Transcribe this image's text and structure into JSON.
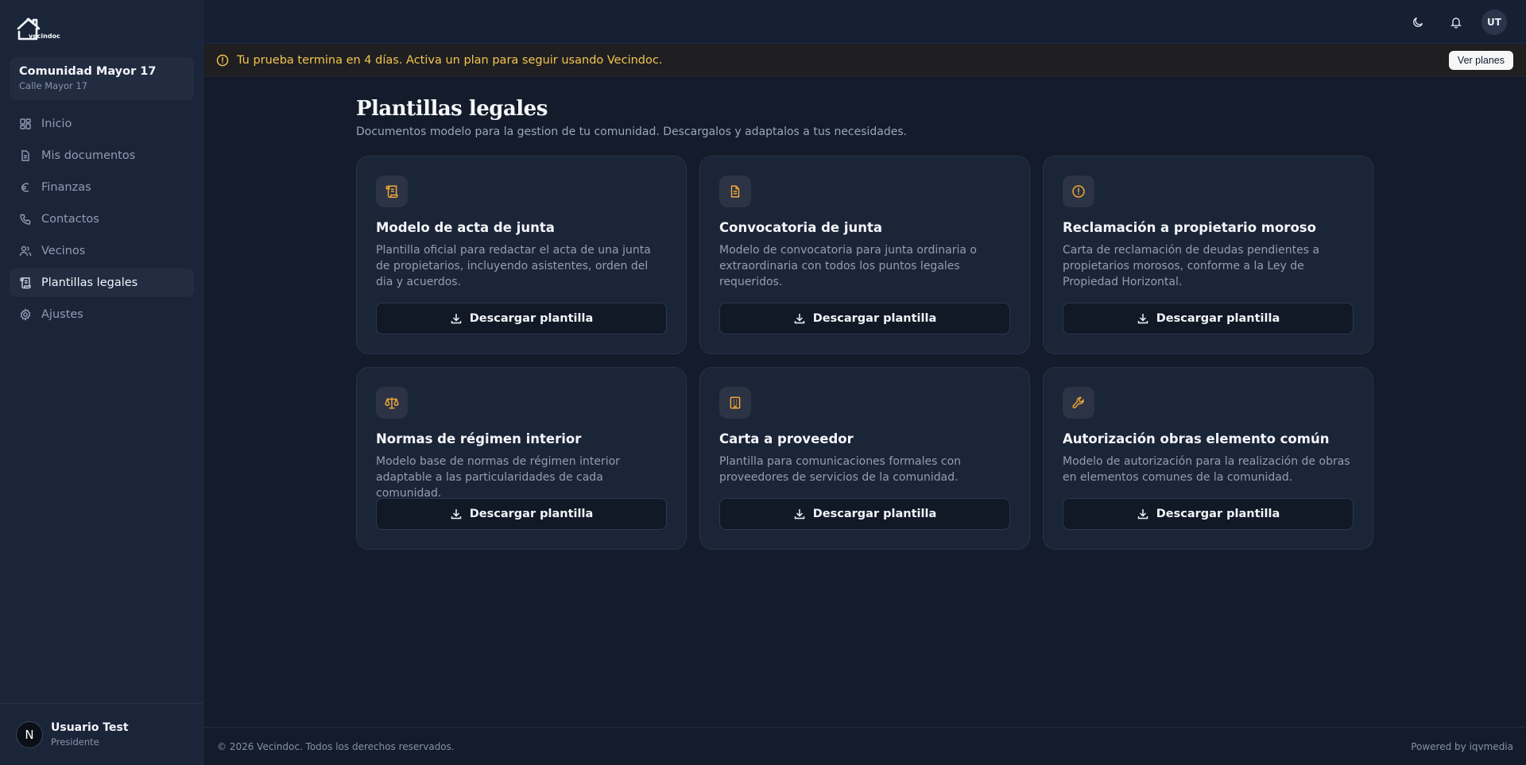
{
  "brand": {
    "logo_text": "vecindoc"
  },
  "community": {
    "name": "Comunidad Mayor 17",
    "address": "Calle Mayor 17"
  },
  "nav": [
    {
      "label": "Inicio",
      "icon": "grid-icon"
    },
    {
      "label": "Mis documentos",
      "icon": "file-icon"
    },
    {
      "label": "Finanzas",
      "icon": "euro-icon"
    },
    {
      "label": "Contactos",
      "icon": "phone-icon"
    },
    {
      "label": "Vecinos",
      "icon": "users-icon"
    },
    {
      "label": "Plantillas legales",
      "icon": "scroll-icon",
      "active": true
    },
    {
      "label": "Ajustes",
      "icon": "gear-icon"
    }
  ],
  "user": {
    "initial": "N",
    "name": "Usuario Test",
    "role": "Presidente"
  },
  "topbar": {
    "avatar_initials": "UT"
  },
  "trial": {
    "message": "Tu prueba termina en 4 días. Activa un plan para seguir usando Vecindoc.",
    "button": "Ver planes"
  },
  "page": {
    "title": "Plantillas legales",
    "subtitle": "Documentos modelo para la gestion de tu comunidad. Descargalos y adaptalos a tus necesidades."
  },
  "cards": [
    {
      "title": "Modelo de acta de junta",
      "description": "Plantilla oficial para redactar el acta de una junta de propietarios, incluyendo asistentes, orden del dia y acuerdos.",
      "button": "Descargar plantilla",
      "icon": "scroll-icon"
    },
    {
      "title": "Convocatoria de junta",
      "description": "Modelo de convocatoria para junta ordinaria o extraordinaria con todos los puntos legales requeridos.",
      "button": "Descargar plantilla",
      "icon": "document-icon"
    },
    {
      "title": "Reclamación a propietario moroso",
      "description": "Carta de reclamación de deudas pendientes a propietarios morosos, conforme a la Ley de Propiedad Horizontal.",
      "button": "Descargar plantilla",
      "icon": "alert-circle-icon"
    },
    {
      "title": "Normas de régimen interior",
      "description": "Modelo base de normas de régimen interior adaptable a las particularidades de cada comunidad.",
      "button": "Descargar plantilla",
      "icon": "scale-icon"
    },
    {
      "title": "Carta a proveedor",
      "description": "Plantilla para comunicaciones formales con proveedores de servicios de la comunidad.",
      "button": "Descargar plantilla",
      "icon": "building-icon"
    },
    {
      "title": "Autorización obras elemento común",
      "description": "Modelo de autorización para la realización de obras en elementos comunes de la comunidad.",
      "button": "Descargar plantilla",
      "icon": "wrench-icon"
    }
  ],
  "footer": {
    "copyright": "© 2026 Vecindoc. Todos los derechos reservados.",
    "powered": "Powered by iqvmedia"
  },
  "colors": {
    "accent": "#f0a73a",
    "warning_text": "#f4c54f",
    "background": "#141c2b",
    "sidebar": "#1b2539"
  }
}
